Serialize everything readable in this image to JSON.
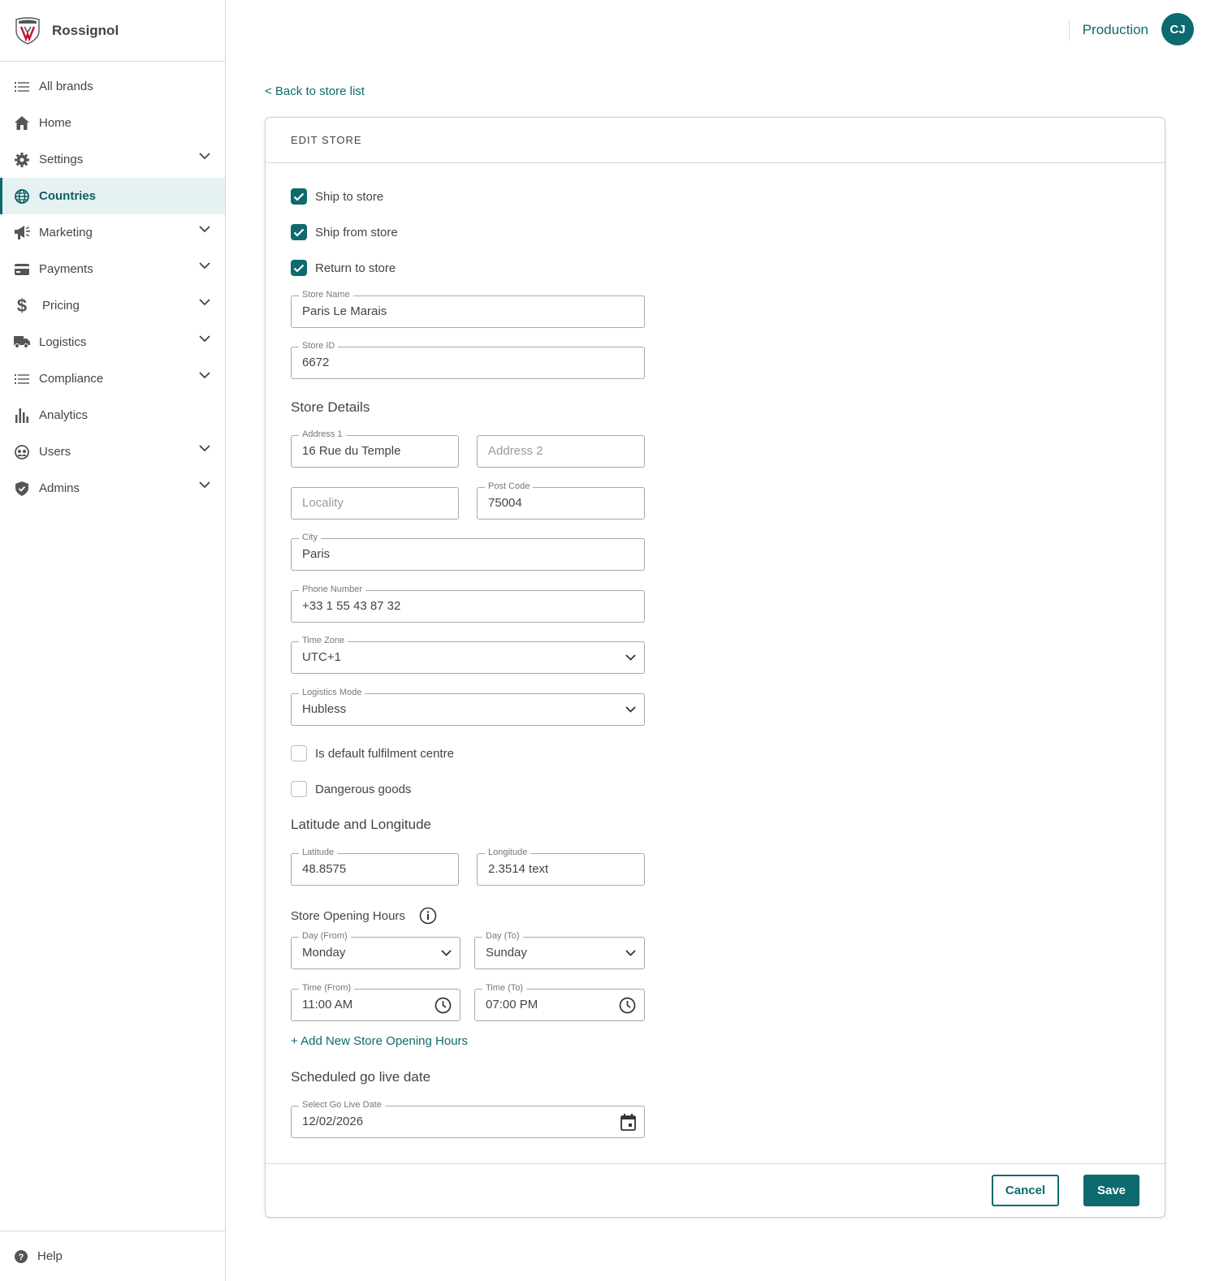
{
  "brand": {
    "name": "Rossignol"
  },
  "sidebar": {
    "items": [
      {
        "label": "All brands",
        "icon": "list-icon"
      },
      {
        "label": "Home",
        "icon": "home-icon"
      },
      {
        "label": "Settings",
        "icon": "gear-icon",
        "expandable": true
      },
      {
        "label": "Countries",
        "icon": "globe-icon",
        "active": true
      },
      {
        "label": "Marketing",
        "icon": "megaphone-icon",
        "expandable": true
      },
      {
        "label": "Payments",
        "icon": "credit-card-icon",
        "expandable": true
      },
      {
        "label": "Pricing",
        "icon": "dollar-icon",
        "expandable": true
      },
      {
        "label": "Logistics",
        "icon": "truck-icon",
        "expandable": true
      },
      {
        "label": "Compliance",
        "icon": "list-icon",
        "expandable": true
      },
      {
        "label": "Analytics",
        "icon": "bar-chart-icon"
      },
      {
        "label": "Users",
        "icon": "users-icon",
        "expandable": true
      },
      {
        "label": "Admins",
        "icon": "shield-icon",
        "expandable": true
      }
    ],
    "help_label": "Help"
  },
  "header": {
    "environment": "Production",
    "avatar_initials": "CJ"
  },
  "back_link": "< Back to store list",
  "card": {
    "title": "EDIT STORE",
    "checkboxes": {
      "ship_to_store": {
        "label": "Ship to store",
        "checked": true
      },
      "ship_from_store": {
        "label": "Ship from store",
        "checked": true
      },
      "return_to_store": {
        "label": "Return to store",
        "checked": true
      },
      "default_fulfilment": {
        "label": "Is default fulfilment centre",
        "checked": false
      },
      "dangerous_goods": {
        "label": "Dangerous goods",
        "checked": false
      }
    },
    "store_name": {
      "label": "Store Name",
      "value": "Paris Le Marais"
    },
    "store_id": {
      "label": "Store ID",
      "value": "6672"
    },
    "store_details_heading": "Store Details",
    "address1": {
      "label": "Address 1",
      "value": "16 Rue du Temple"
    },
    "address2": {
      "placeholder": "Address 2"
    },
    "locality": {
      "placeholder": "Locality"
    },
    "post_code": {
      "label": "Post Code",
      "value": "75004"
    },
    "city": {
      "label": "City",
      "value": "Paris"
    },
    "phone": {
      "label": "Phone Number",
      "value": "+33 1 55 43 87 32"
    },
    "time_zone": {
      "label": "Time Zone",
      "value": "UTC+1"
    },
    "logistics_mode": {
      "label": "Logistics Mode",
      "value": "Hubless"
    },
    "latlng_heading": "Latitude and Longitude",
    "latitude": {
      "label": "Latitude",
      "value": "48.8575"
    },
    "longitude": {
      "label": "Longitude",
      "value": "2.3514 text"
    },
    "opening_hours_heading": "Store Opening Hours",
    "day_from": {
      "label": "Day (From)",
      "value": "Monday"
    },
    "day_to": {
      "label": "Day (To)",
      "value": "Sunday"
    },
    "time_from": {
      "label": "Time (From)",
      "value": "11:00 AM"
    },
    "time_to": {
      "label": "Time (To)",
      "value": "07:00 PM"
    },
    "add_hours_link": "+ Add New Store Opening Hours",
    "go_live_heading": "Scheduled go live date",
    "go_live_date": {
      "label": "Select Go Live Date",
      "value": "12/02/2026"
    },
    "cancel_label": "Cancel",
    "save_label": "Save"
  },
  "colors": {
    "accent": "#0d6a6e",
    "active_bg": "#e6f1f1",
    "border": "#a9a9a9"
  }
}
